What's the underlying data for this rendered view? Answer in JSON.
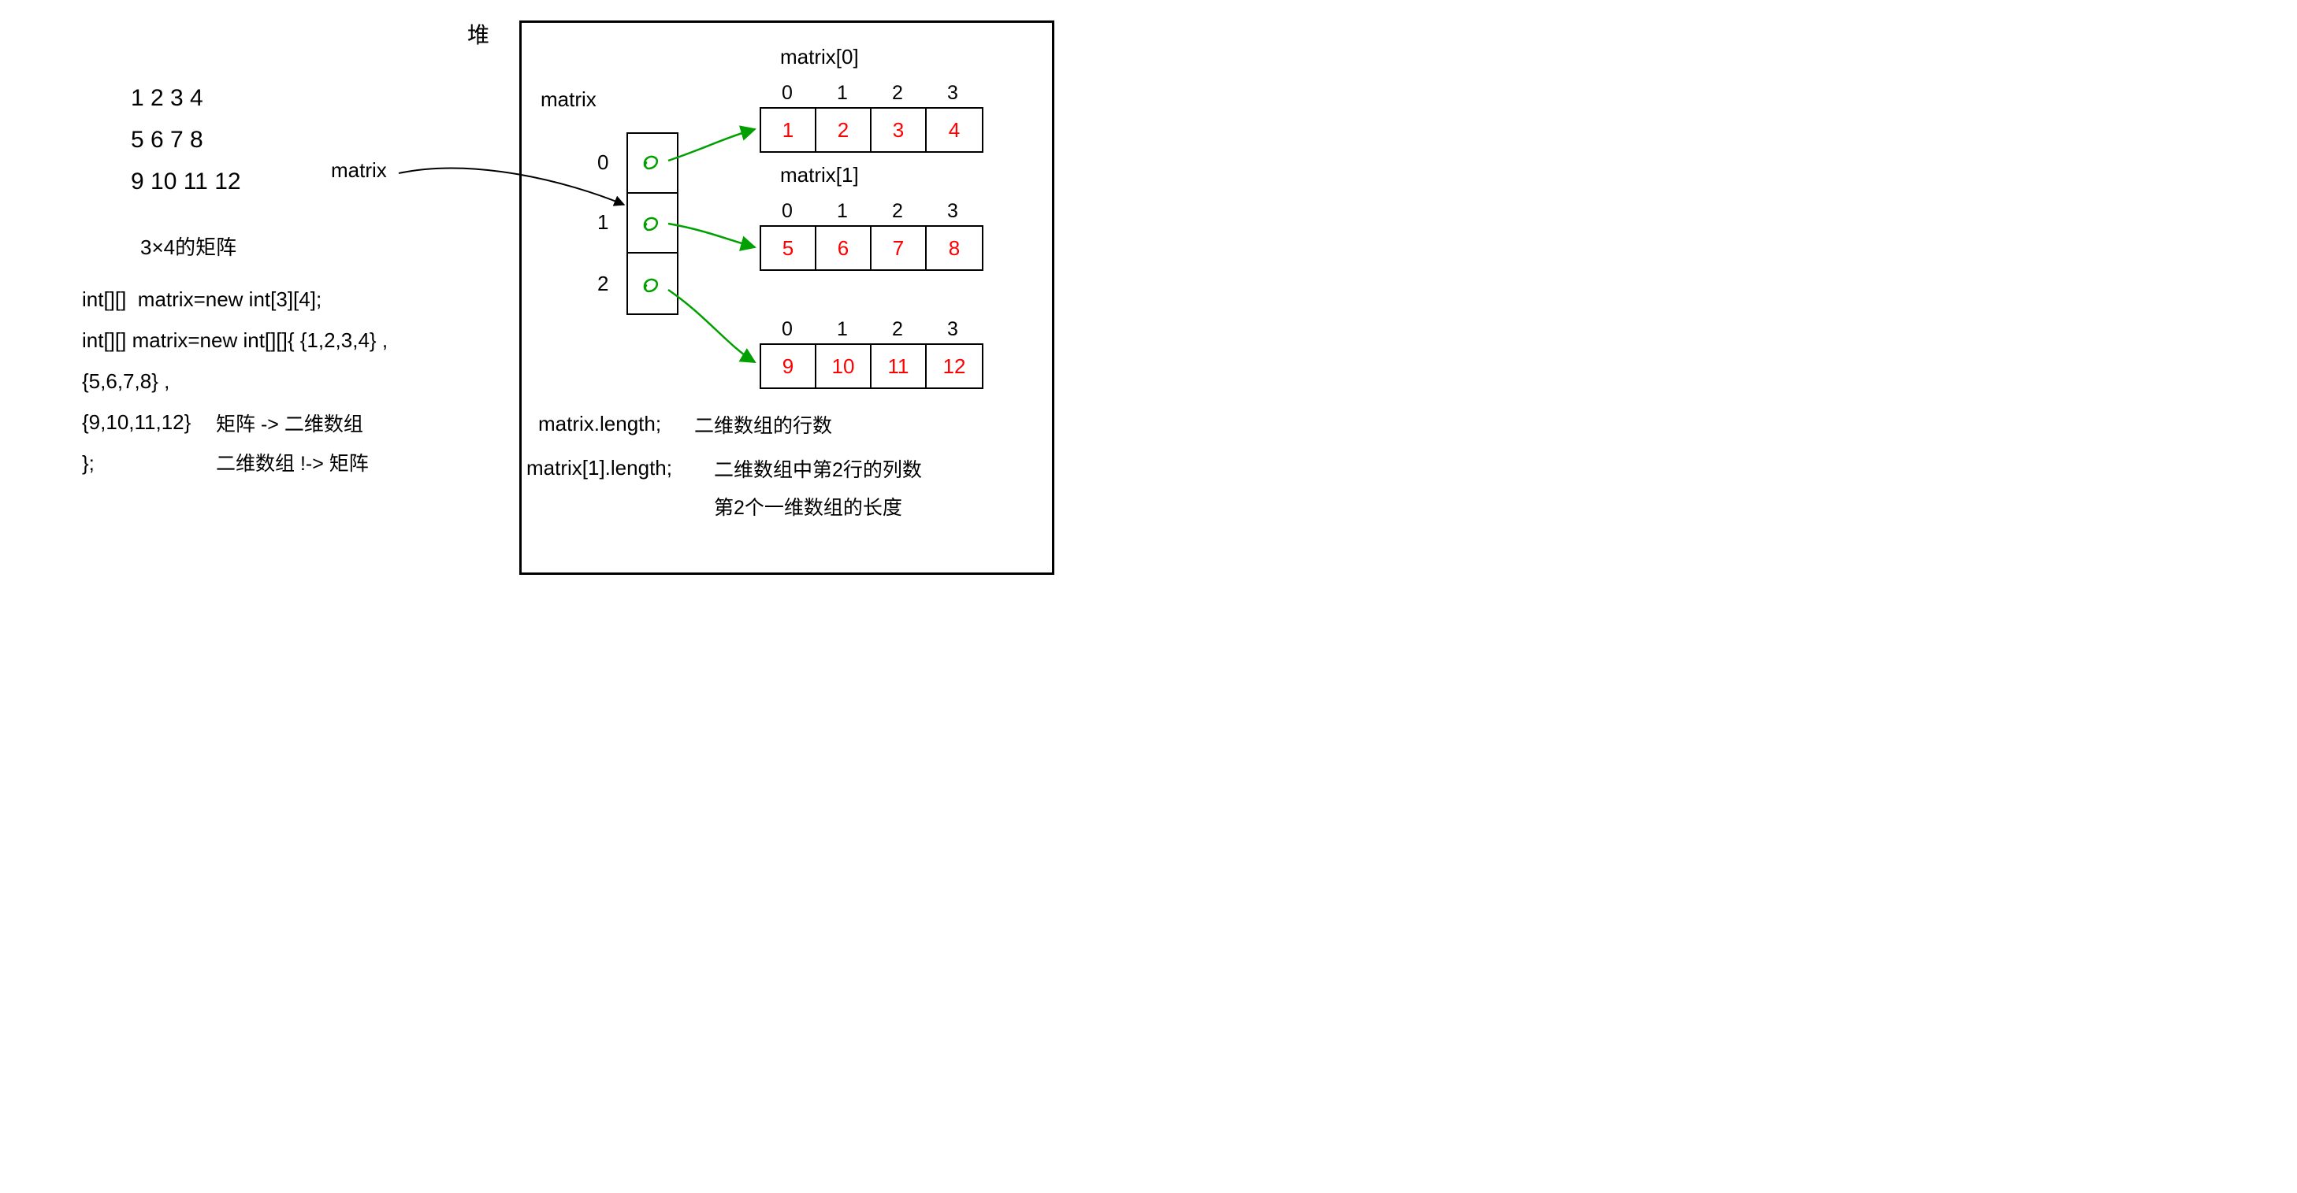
{
  "labels": {
    "heap_title": "堆",
    "matrix_word_left": "matrix",
    "matrix_word_top": "matrix",
    "arr0_label": "matrix[0]",
    "arr1_label": "matrix[1]",
    "desc_dim": "3×4的矩阵",
    "code_line1": "int[][]  matrix=new int[3][4];",
    "code_line2": "int[][] matrix=new int[][]{ {1,2,3,4} ,",
    "code_line3": "{5,6,7,8} ,",
    "code_line4": "{9,10,11,12}",
    "code_line5": "};",
    "map1": "矩阵 -> 二维数组",
    "map2": "二维数组 !-> 矩阵",
    "len1_left": "matrix.length;",
    "len1_right": "二维数组的行数",
    "len2_left": "matrix[1].length;",
    "len2_right": "二维数组中第2行的列数",
    "len3": "第2个一维数组的长度"
  },
  "left_matrix_rows": [
    "1 2 3 4",
    "5 6 7 8",
    "9 10 11 12"
  ],
  "outer_indices": [
    "0",
    "1",
    "2"
  ],
  "col_indices": [
    "0",
    "1",
    "2",
    "3"
  ],
  "row_data": {
    "r0": [
      "1",
      "2",
      "3",
      "4"
    ],
    "r1": [
      "5",
      "6",
      "7",
      "8"
    ],
    "r2": [
      "9",
      "10",
      "11",
      "12"
    ]
  },
  "chart_data": {
    "type": "table",
    "title": "2D array (Java int[3][4]) heap layout",
    "rows": 3,
    "cols": 4,
    "data": [
      [
        1,
        2,
        3,
        4
      ],
      [
        5,
        6,
        7,
        8
      ],
      [
        9,
        10,
        11,
        12
      ]
    ]
  }
}
